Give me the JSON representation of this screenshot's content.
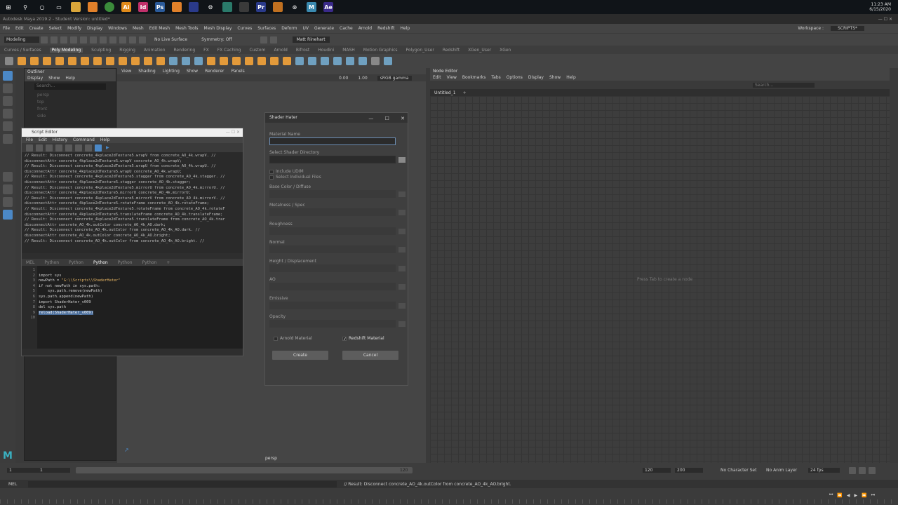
{
  "taskbar": {
    "time": "11:23 AM",
    "date": "6/15/2020"
  },
  "window_title": "Autodesk Maya 2019.2 - Student Version: untitled*",
  "menubar": [
    "File",
    "Edit",
    "Create",
    "Select",
    "Modify",
    "Display",
    "Windows",
    "Mesh",
    "Edit Mesh",
    "Mesh Tools",
    "Mesh Display",
    "Curves",
    "Surfaces",
    "Deform",
    "UV",
    "Generate",
    "Cache",
    "Arnold",
    "Redshift",
    "Help"
  ],
  "statusline": {
    "mode": "Modeling",
    "live_surface": "No Live Surface",
    "symmetry": "Symmetry: Off",
    "user": "Matt Rinehart",
    "workspace_label": "Workspace :",
    "workspace": "SCRIPTS*"
  },
  "shelf_tabs": [
    "Curves / Surfaces",
    "Poly Modeling",
    "Sculpting",
    "Rigging",
    "Animation",
    "Rendering",
    "FX",
    "FX Caching",
    "Custom",
    "Arnold",
    "Bifrost",
    "Houdini",
    "MASH",
    "Motion Graphics",
    "Polygon_User",
    "Redshift",
    "XGen_User",
    "XGen"
  ],
  "shelf_active": "Poly Modeling",
  "outliner": {
    "title": "Outliner",
    "menu": [
      "Display",
      "Show",
      "Help"
    ],
    "search": "Search...",
    "items": [
      "persp",
      "top",
      "front",
      "side",
      "defaultLightSet"
    ]
  },
  "viewport": {
    "menu": [
      "View",
      "Shading",
      "Lighting",
      "Show",
      "Renderer",
      "Panels"
    ],
    "value_a": "0.00",
    "value_b": "1.00",
    "color_space": "sRGB gamma",
    "camera_label": "persp"
  },
  "script_editor": {
    "title": "Script Editor",
    "menu": [
      "File",
      "Edit",
      "History",
      "Command",
      "Help"
    ],
    "output": [
      "// Result: Disconnect concrete_4kplace2dTexture5.wrapV from concrete_AO_4k.wrapV. //",
      "disconnectAttr concrete_4kplace2dTexture5.wrapV concrete_AO_4k.wrapV;",
      "// Result: Disconnect concrete_4kplace2dTexture5.wrapU from concrete_AO_4k.wrapU. //",
      "disconnectAttr concrete_4kplace2dTexture5.wrapU concrete_AO_4k.wrapU;",
      "// Result: Disconnect concrete_4kplace2dTexture5.stagger from concrete_AO_4k.stagger. //",
      "disconnectAttr concrete_4kplace2dTexture5.stagger concrete_AO_4k.stagger;",
      "// Result: Disconnect concrete_4kplace2dTexture5.mirrorU from concrete_AO_4k.mirrorU. //",
      "disconnectAttr concrete_4kplace2dTexture5.mirrorU concrete_AO_4k.mirrorU;",
      "// Result: Disconnect concrete_4kplace2dTexture5.mirrorV from concrete_AO_4k.mirrorV. //",
      "disconnectAttr concrete_4kplace2dTexture5.rotateFrame concrete_AO_4k.rotateFrame;",
      "// Result: Disconnect concrete_4kplace2dTexture5.rotateFrame from concrete_AO_4k.rotateF",
      "disconnectAttr concrete_4kplace2dTexture5.translateFrame concrete_AO_4k.translateFrame;",
      "// Result: Disconnect concrete_4kplace2dTexture5.translateFrame from concrete_AO_4k.trar",
      "disconnectAttr concrete_AO_4k.outColor concrete_AO_4k_AO.dark;",
      "// Result: Disconnect concrete_AO_4k.outColor from concrete_AO_4k_AO.dark. //",
      "disconnectAttr concrete_AO_4k.outColor concrete_AO_4k_AO.bright;",
      "// Result: Disconnect concrete_AO_4k.outColor from concrete_AO_4k_AO.bright. //"
    ],
    "tabs": [
      "MEL",
      "Python",
      "Python",
      "Python",
      "Python",
      "Python"
    ],
    "active_tab_index": 3,
    "line_numbers": [
      "1",
      "2",
      "3",
      "4",
      "5",
      "6",
      "7",
      "8",
      "9",
      "10"
    ],
    "code": {
      "l1": "import sys",
      "l2": "",
      "l3a": "newPath = ",
      "l3b": "\"G:\\\\Scripts\\\\ShaderHater\"",
      "l4": "if not newPath in sys.path:",
      "l5": "    sys.path.remove(newPath)",
      "l6": "",
      "l7": "sys.path.append(newPath)",
      "l8": "import ShaderHater_v009",
      "l9": "del sys.path",
      "l10": "reload(ShaderHater_v009)"
    }
  },
  "shader_hater": {
    "title": "Shader Hater",
    "material_name_label": "Material Name",
    "material_name_value": "",
    "shader_dir_label": "Select Shader Directory",
    "include_udim": "Include UDIM",
    "select_individual": "Select Individual Files",
    "maps": [
      "Base Color / Diffuse",
      "Metalness / Spec",
      "Roughness",
      "Normal",
      "Height / Displacement",
      "AO",
      "Emissive",
      "Opacity"
    ],
    "arnold_label": "Arnold Material",
    "arnold_checked": false,
    "redshift_label": "Redshift Material",
    "redshift_checked": true,
    "create_label": "Create",
    "cancel_label": "Cancel"
  },
  "node_editor": {
    "title": "Node Editor",
    "menu": [
      "Edit",
      "View",
      "Bookmarks",
      "Tabs",
      "Options",
      "Display",
      "Show",
      "Help"
    ],
    "tab": "Untitled_1",
    "search": "Search...",
    "hint": "Press Tab to create a node"
  },
  "timeline": {
    "start": "1",
    "start2": "1",
    "end_inner": "120",
    "end_a": "120",
    "end_b": "200",
    "character_set": "No Character Set",
    "anim_layer": "No Anim Layer",
    "fps": "24 fps"
  },
  "command_line": {
    "label": "MEL",
    "result": "// Result: Disconnect concrete_AO_4k.outColor from concrete_AO_4k_AO.bright."
  },
  "colors": {
    "accent": "#4b88c6",
    "shelf_orange": "#e39a3a"
  }
}
